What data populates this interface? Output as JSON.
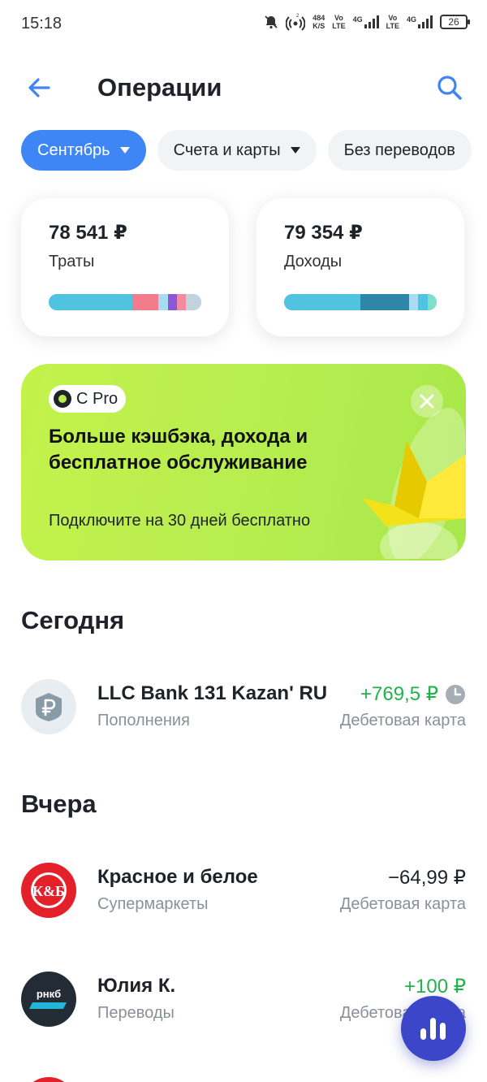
{
  "status_bar": {
    "time": "15:18",
    "speed_value": "484",
    "speed_unit": "K/S",
    "net1_top": "Vo",
    "net1_bottom": "LTE",
    "net1_gen": "4G",
    "net2_top": "Vo",
    "net2_bottom": "LTE",
    "net2_gen": "4G",
    "battery": "26"
  },
  "header": {
    "title": "Операции",
    "back_icon": "arrow-left-icon",
    "search_icon": "search-icon"
  },
  "filters": [
    {
      "label": "Сентябрь",
      "active": true
    },
    {
      "label": "Счета и карты",
      "active": false
    },
    {
      "label": "Без переводов",
      "active": false
    }
  ],
  "summary": {
    "spending": {
      "amount": "78 541 ₽",
      "label": "Траты",
      "segments": [
        {
          "share": 0.55,
          "color": "#4fc3df"
        },
        {
          "share": 0.17,
          "color": "#f27b8c"
        },
        {
          "share": 0.06,
          "color": "#a7dcf3"
        },
        {
          "share": 0.06,
          "color": "#8a57d6"
        },
        {
          "share": 0.06,
          "color": "#f48aa0"
        },
        {
          "share": 0.1,
          "color": "#c3d3de"
        }
      ]
    },
    "income": {
      "amount": "79 354 ₽",
      "label": "Доходы",
      "segments": [
        {
          "share": 0.5,
          "color": "#4fc3df"
        },
        {
          "share": 0.32,
          "color": "#2e86a8"
        },
        {
          "share": 0.06,
          "color": "#a7dcf3"
        },
        {
          "share": 0.06,
          "color": "#4fc3df"
        },
        {
          "share": 0.06,
          "color": "#7ee0c8"
        }
      ]
    }
  },
  "promo": {
    "badge": "С Pro",
    "title": "Больше кэшбэка, дохода и бесплатное обслуживание",
    "subtitle": "Подключите на 30 дней бесплатно",
    "close_icon": "close-icon"
  },
  "sections": {
    "today": "Сегодня",
    "yesterday": "Вчера"
  },
  "operations": [
    {
      "name": "LLC Bank 131 Kazan' RU",
      "category": "Пополнения",
      "amount": "+769,5 ₽",
      "account": "Дебетовая карта",
      "icon": "ruble-icon",
      "pending": true
    },
    {
      "name": "Красное и белое",
      "category": "Супермаркеты",
      "amount": "−64,99 ₽",
      "account": "Дебетовая карта",
      "icon": "logo-text",
      "logo_text": "К&Б"
    },
    {
      "name": "Юлия К.",
      "category": "Переводы",
      "amount": "+100 ₽",
      "account": "Дебетовая карта",
      "icon": "logo-text",
      "logo_text": "рнкб"
    }
  ],
  "colors": {
    "accent": "#3e86f5",
    "income_green": "#21b24b",
    "promo_green": "#b9ee50",
    "fab": "#3c46c8"
  },
  "fab_icon": "analytics-chart-icon"
}
